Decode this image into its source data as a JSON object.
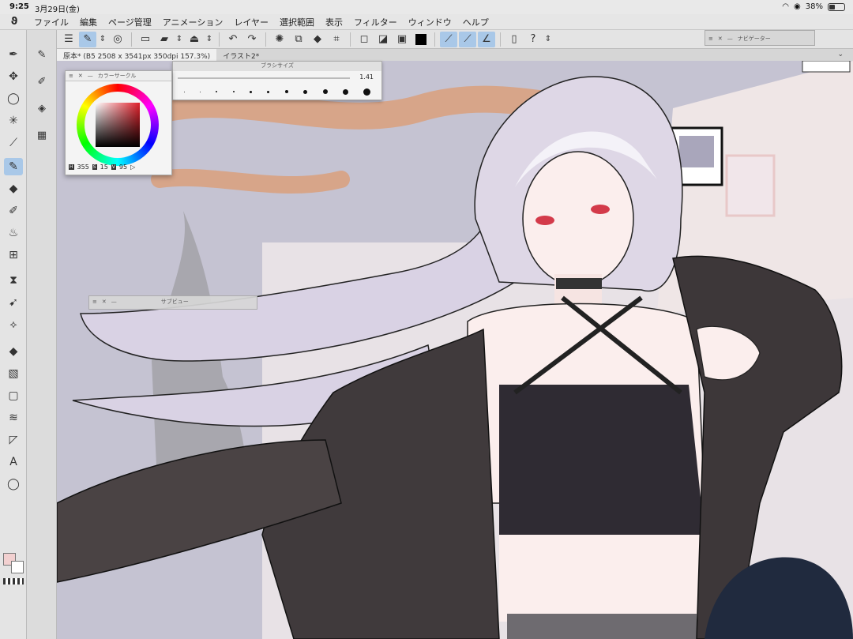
{
  "status": {
    "time": "9:25",
    "date": "3月29日(金)",
    "battery": "38%",
    "battery_level": 0.38
  },
  "menu": [
    "ファイル",
    "編集",
    "ページ管理",
    "アニメーション",
    "レイヤー",
    "選択範囲",
    "表示",
    "フィルター",
    "ウィンドウ",
    "ヘルプ"
  ],
  "tabs": [
    {
      "label": "原本* (B5 2508 x 3541px 350dpi 157.3%)"
    },
    {
      "label": "イラスト2*"
    }
  ],
  "brush_panel": {
    "title": "ブラシサイズ",
    "value": "1.41"
  },
  "color_panel": {
    "title": "カラーサークル",
    "h_tag": "H",
    "h": "355",
    "s_tag": "S",
    "s": "15",
    "v_tag": "V",
    "v": "95"
  },
  "subview_panel": {
    "title": "サブビュー"
  },
  "navigator_panel": {
    "title": "ナビゲーター"
  },
  "colors": {
    "main": "#f2d0d0",
    "sub": "#ffffff",
    "accent": "#a9c8e8"
  },
  "tools": [
    "pen-tool",
    "move-layer-icon",
    "lasso-icon",
    "magic-wand-icon",
    "eyedropper-icon",
    "pen-icon",
    "eraser-icon",
    "decoration-icon",
    "airbrush-icon",
    "ruler-grid-icon",
    "blend-icon",
    "figure-icon",
    "object-icon",
    "fill-icon",
    "gradient-icon",
    "rectangle-icon",
    "frame-icon",
    "line-icon",
    "text-icon",
    "balloon-icon"
  ]
}
